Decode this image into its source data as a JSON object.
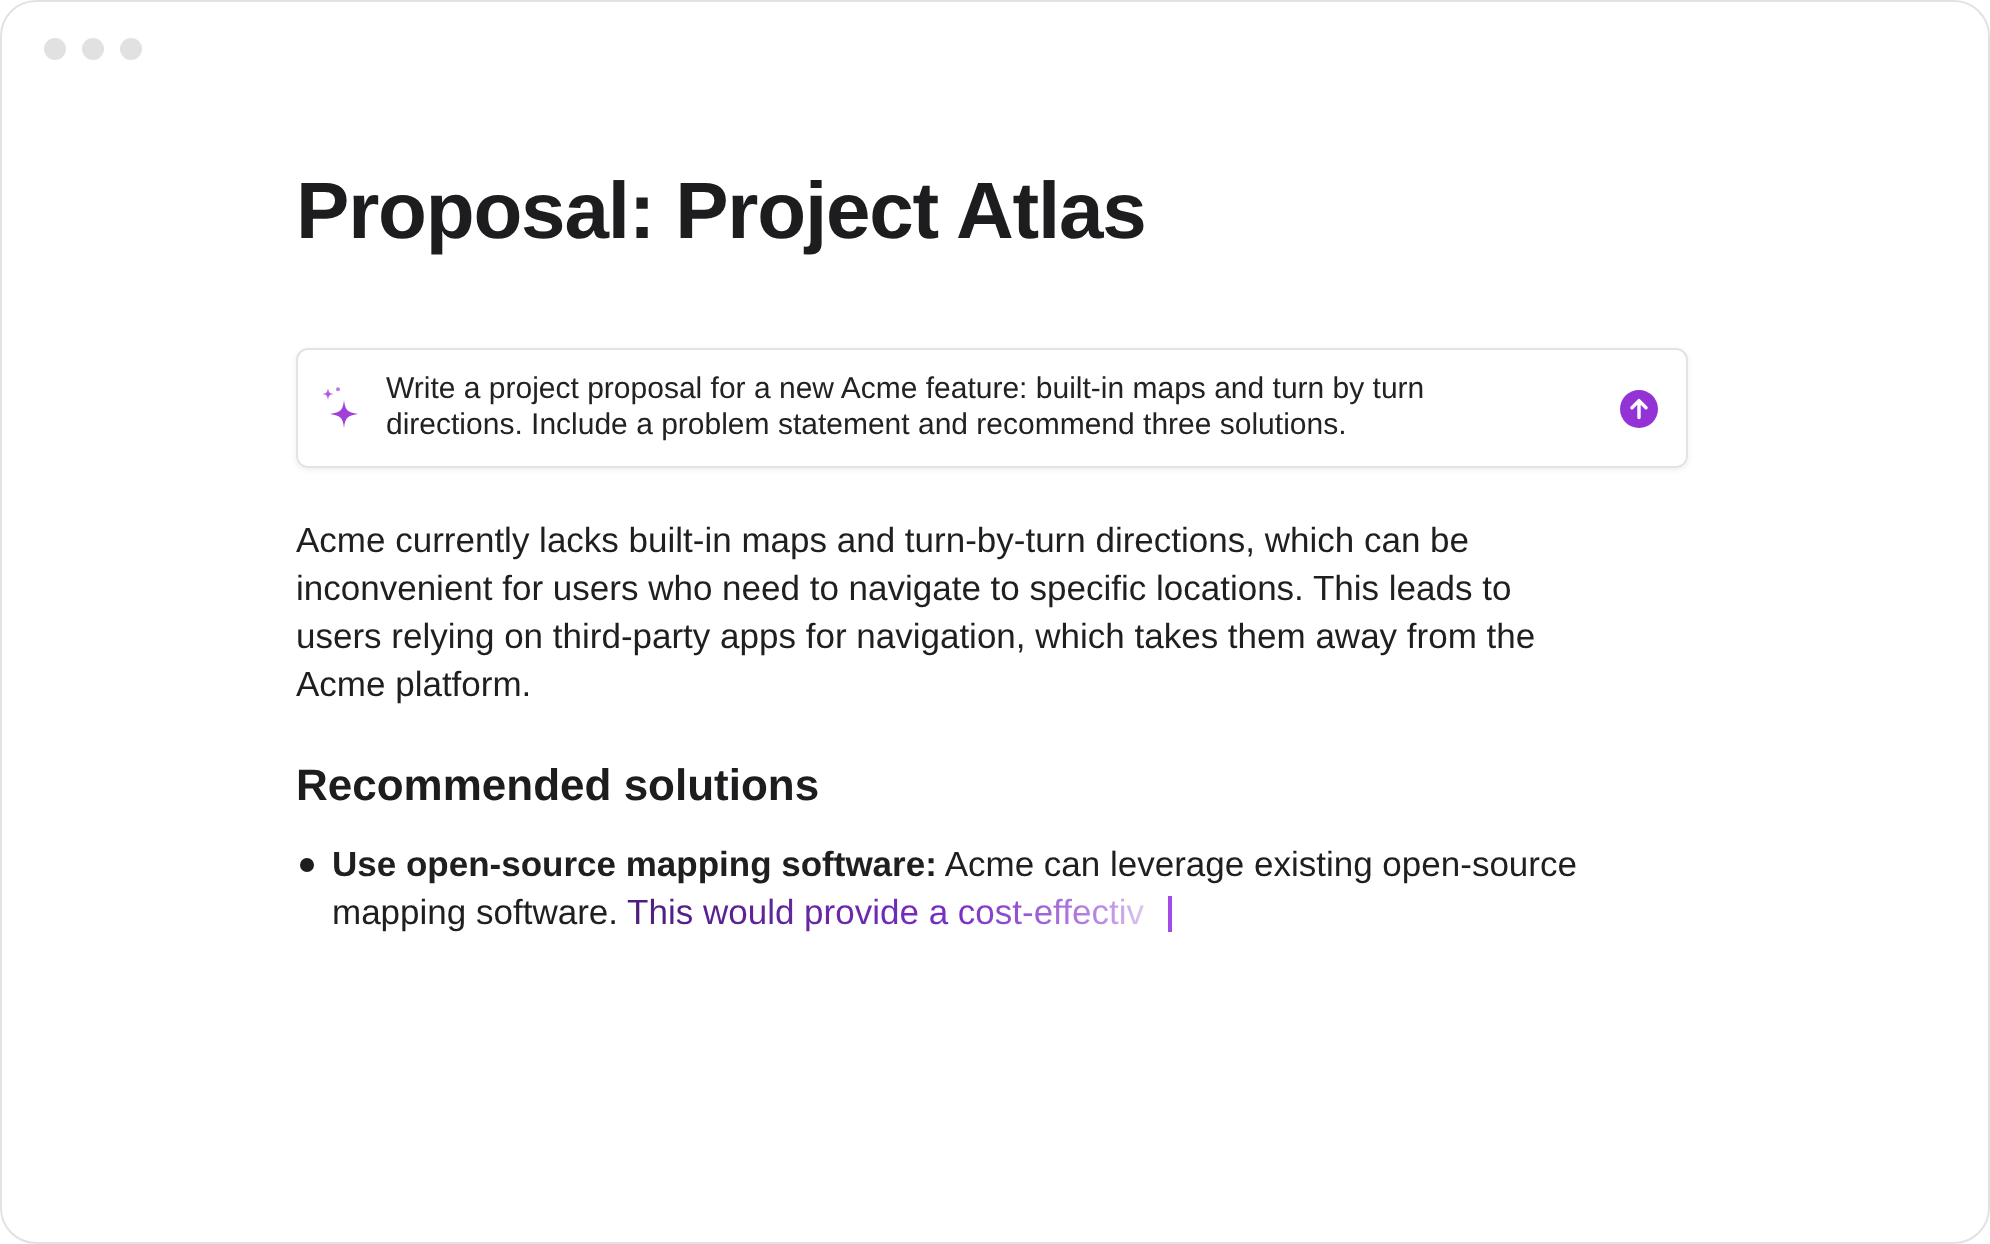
{
  "document": {
    "title": "Proposal: Project Atlas"
  },
  "prompt": {
    "text": "Write a project proposal for a new Acme feature: built-in maps and turn by turn directions. Include a problem statement and recommend three solutions."
  },
  "body": [
    {
      "kind": "paragraph",
      "text": "Acme currently lacks built-in maps and turn-by-turn directions, which can be inconvenient for users who need to navigate to specific locations. This leads to users relying on third-party apps for navigation, which takes them away from the Acme platform."
    },
    {
      "kind": "heading",
      "text": "Recommended solutions"
    },
    {
      "kind": "bullet",
      "text": "**Use open-source mapping software:** Acme can leverage existing open-source mapping software.",
      "generating": "This would provide a cost-effectiv",
      "cursor": true
    }
  ]
}
